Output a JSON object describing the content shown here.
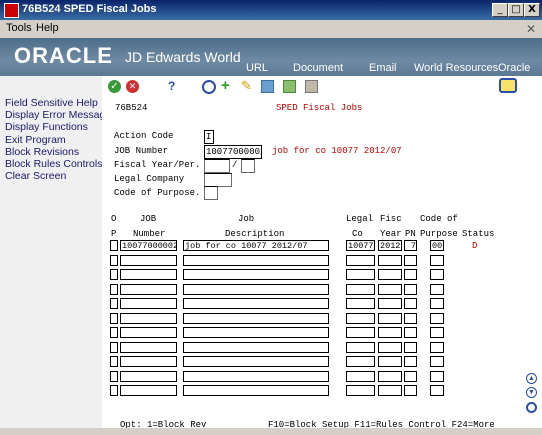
{
  "window": {
    "title": "76B524   SPED Fiscal Jobs",
    "minimize": "_",
    "maximize": "□",
    "close": "X"
  },
  "menu": {
    "tools": "Tools",
    "help": "Help"
  },
  "banner": {
    "logo": "ORACLE",
    "product": "JD Edwards World",
    "nav": [
      "URL",
      "Document",
      "Email",
      "World Resources",
      "Oracle"
    ]
  },
  "sidebar": {
    "items": [
      "Field Sensitive Help",
      "Display Error Message",
      "Display Functions",
      "Exit Program",
      "Block Revisions",
      "Block Rules Controls",
      "Clear Screen"
    ]
  },
  "toolbar": {
    "icons": [
      "check-icon",
      "cancel-icon",
      "help-icon",
      "binoculars-icon",
      "add-icon",
      "pencil-icon",
      "copy-icon",
      "paste-icon",
      "delete-icon",
      "chat-icon",
      "search-icon"
    ]
  },
  "screen": {
    "program": "76B524",
    "heading": "SPED Fiscal Jobs",
    "labels": {
      "action_code": "Action Code",
      "job_number": "JOB Number",
      "fiscal_year": "Fiscal Year/Per.",
      "legal_company": "Legal Company",
      "code_of_purpose": "Code of Purpose."
    },
    "values": {
      "action_code": "I",
      "job_number": "10077000002",
      "job_description": "job for co 10077 2012/07",
      "slash": "/"
    }
  },
  "grid": {
    "headers": {
      "op1": "O",
      "op2": "P",
      "job1": "JOB",
      "job2": "Number",
      "desc1": "Job",
      "desc2": "Description",
      "legal1": "Legal",
      "legal2": "Co",
      "fisc1": "Fisc",
      "fisc2": "Year",
      "pn2": "PN",
      "cp1": "Code of",
      "cp2": "Purpose",
      "status2": "Status"
    },
    "rows": [
      {
        "op": "",
        "job": "10077000002",
        "desc": "job for co 10077 2012/07",
        "legal": "10077",
        "year": "2012",
        "pn": "7",
        "purpose": "00",
        "status": "D"
      }
    ],
    "empty_rows": 10
  },
  "footer": {
    "opt": "Opt:  1=Block Rev",
    "keys": "F10=Block Setup  F11=Rules Control  F24=More"
  },
  "colors": {
    "accent_red": "#c00000",
    "banner": "#5b7894",
    "title_bar": "#0a246a"
  }
}
